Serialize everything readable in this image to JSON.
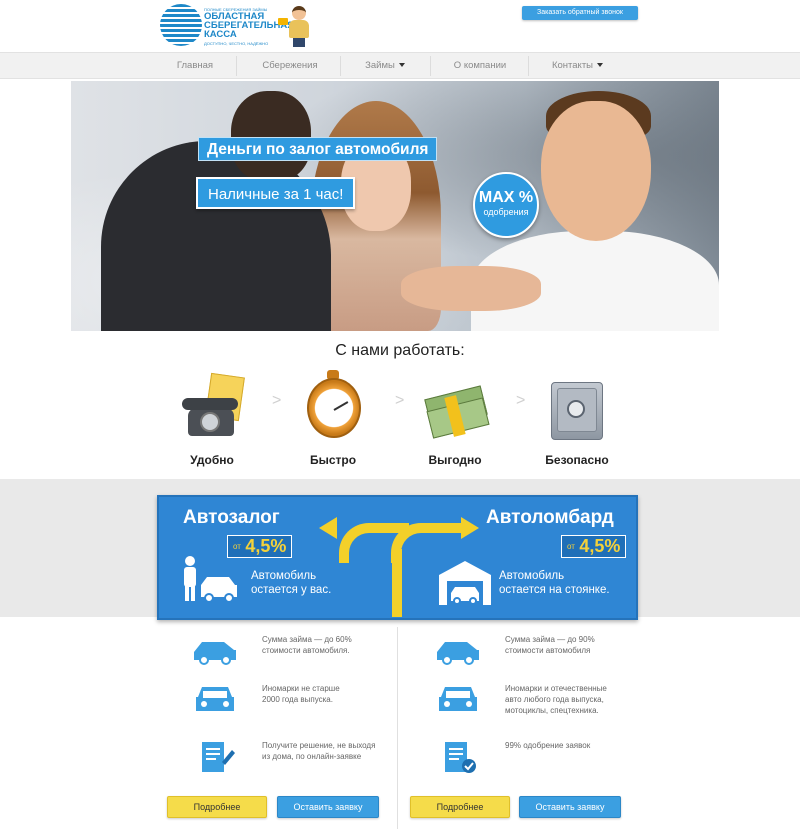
{
  "header": {
    "logo_small": "ПОЛНЫЕ СБЕРЕЖЕНИЯ ЗАЙМЫ",
    "logo_name": "ОБЛАСТНАЯ СБЕРЕГАТЕЛЬНАЯ КАССА",
    "logo_tagline": "ДОСТУПНО, ЧЕСТНО, НАДЁЖНО",
    "callback_label": "Заказать обратный звонок"
  },
  "nav": {
    "items": [
      {
        "label": "Главная"
      },
      {
        "label": "Сбережения"
      },
      {
        "label": "Займы"
      },
      {
        "label": "О компании"
      },
      {
        "label": "Контакты"
      }
    ]
  },
  "hero": {
    "title": "Деньги по залог автомобиля",
    "subtitle": "Наличные за 1 час!",
    "badge_main": "MAX %",
    "badge_sub": "одобрения"
  },
  "benefits": {
    "title": "С нами работать:",
    "items": [
      {
        "label": "Удобно",
        "icon": "phone-icon"
      },
      {
        "label": "Быстро",
        "icon": "stopwatch-icon"
      },
      {
        "label": "Выгодно",
        "icon": "money-icon"
      },
      {
        "label": "Безопасно",
        "icon": "safe-icon"
      }
    ],
    "separator": ">"
  },
  "offers": {
    "left": {
      "title": "Автозалог",
      "rate_from": "от",
      "rate_value": "4,5%",
      "text_line1": "Автомобиль",
      "text_line2": "остается у вас."
    },
    "right": {
      "title": "Автоломбард",
      "rate_from": "от",
      "rate_value": "4,5%",
      "text_line1": "Автомобиль",
      "text_line2": "остается на стоянке."
    }
  },
  "details": {
    "left": [
      {
        "line1": "Сумма займа — до 60%",
        "line2": "стоимости автомобиля."
      },
      {
        "line1": "Иномарки не старше",
        "line2": "2000 года выпуска."
      },
      {
        "line1": "Получите решение, не выходя",
        "line2": "из дома, по онлайн-заявке"
      }
    ],
    "right": [
      {
        "line1": "Сумма займа — до 90%",
        "line2": "стоимости автомобиля"
      },
      {
        "line1": "Иномарки и отечественные",
        "line2": "авто любого года выпуска,",
        "line3": "мотоциклы, спецтехника."
      },
      {
        "line1": "99% одобрение заявок"
      }
    ],
    "more_label": "Подробнее",
    "apply_label": "Оставить заявку"
  },
  "colors": {
    "brand_blue": "#2f9be0",
    "offer_blue": "#2f86d4",
    "accent_yellow": "#f3d02a"
  }
}
